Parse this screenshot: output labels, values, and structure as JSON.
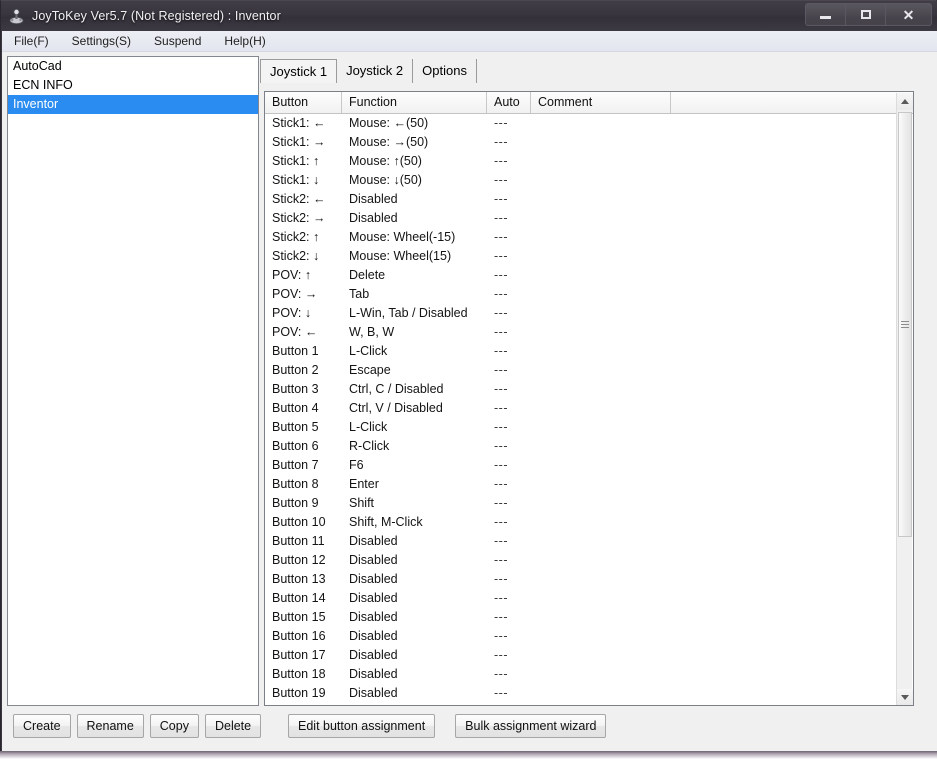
{
  "window": {
    "title": "JoyToKey Ver5.7 (Not Registered) : Inventor",
    "icon": "joystick-icon",
    "controls": {
      "minimize": "minimize-icon",
      "maximize": "maximize-icon",
      "close": "✕"
    }
  },
  "menubar": {
    "items": [
      {
        "label": "File(F)"
      },
      {
        "label": "Settings(S)"
      },
      {
        "label": "Suspend"
      },
      {
        "label": "Help(H)"
      }
    ]
  },
  "sidebar": {
    "profiles": [
      {
        "label": "AutoCad",
        "selected": false
      },
      {
        "label": "ECN INFO",
        "selected": false
      },
      {
        "label": "Inventor",
        "selected": true
      }
    ],
    "buttons": [
      {
        "label": "Create"
      },
      {
        "label": "Rename"
      },
      {
        "label": "Copy"
      },
      {
        "label": "Delete"
      }
    ],
    "selected_color": "#2a8cf0"
  },
  "main": {
    "tabs": [
      {
        "label": "Joystick 1",
        "active": true
      },
      {
        "label": "Joystick 2",
        "active": false
      },
      {
        "label": "Options",
        "active": false
      }
    ],
    "table": {
      "columns": [
        "Button",
        "Function",
        "Auto",
        "Comment",
        ""
      ],
      "rows": [
        {
          "button": "Stick1: ←",
          "function": "Mouse: ←(50)",
          "auto": "---",
          "comment": ""
        },
        {
          "button": "Stick1: →",
          "function": "Mouse: →(50)",
          "auto": "---",
          "comment": ""
        },
        {
          "button": "Stick1: ↑",
          "function": "Mouse: ↑(50)",
          "auto": "---",
          "comment": ""
        },
        {
          "button": "Stick1: ↓",
          "function": "Mouse: ↓(50)",
          "auto": "---",
          "comment": ""
        },
        {
          "button": "Stick2: ←",
          "function": "Disabled",
          "auto": "---",
          "comment": ""
        },
        {
          "button": "Stick2: →",
          "function": "Disabled",
          "auto": "---",
          "comment": ""
        },
        {
          "button": "Stick2: ↑",
          "function": "Mouse: Wheel(-15)",
          "auto": "---",
          "comment": ""
        },
        {
          "button": "Stick2: ↓",
          "function": "Mouse: Wheel(15)",
          "auto": "---",
          "comment": ""
        },
        {
          "button": "POV: ↑",
          "function": "Delete",
          "auto": "---",
          "comment": ""
        },
        {
          "button": "POV: →",
          "function": "Tab",
          "auto": "---",
          "comment": ""
        },
        {
          "button": "POV: ↓",
          "function": "L-Win, Tab / Disabled",
          "auto": "---",
          "comment": ""
        },
        {
          "button": "POV: ←",
          "function": "W, B, W",
          "auto": "---",
          "comment": ""
        },
        {
          "button": "Button 1",
          "function": "L-Click",
          "auto": "---",
          "comment": ""
        },
        {
          "button": "Button 2",
          "function": "Escape",
          "auto": "---",
          "comment": ""
        },
        {
          "button": "Button 3",
          "function": "Ctrl, C / Disabled",
          "auto": "---",
          "comment": ""
        },
        {
          "button": "Button 4",
          "function": "Ctrl, V / Disabled",
          "auto": "---",
          "comment": ""
        },
        {
          "button": "Button 5",
          "function": "L-Click",
          "auto": "---",
          "comment": ""
        },
        {
          "button": "Button 6",
          "function": "R-Click",
          "auto": "---",
          "comment": ""
        },
        {
          "button": "Button 7",
          "function": "F6",
          "auto": "---",
          "comment": ""
        },
        {
          "button": "Button 8",
          "function": "Enter",
          "auto": "---",
          "comment": ""
        },
        {
          "button": "Button 9",
          "function": "Shift",
          "auto": "---",
          "comment": ""
        },
        {
          "button": "Button 10",
          "function": "Shift, M-Click",
          "auto": "---",
          "comment": ""
        },
        {
          "button": "Button 11",
          "function": "Disabled",
          "auto": "---",
          "comment": ""
        },
        {
          "button": "Button 12",
          "function": "Disabled",
          "auto": "---",
          "comment": ""
        },
        {
          "button": "Button 13",
          "function": "Disabled",
          "auto": "---",
          "comment": ""
        },
        {
          "button": "Button 14",
          "function": "Disabled",
          "auto": "---",
          "comment": ""
        },
        {
          "button": "Button 15",
          "function": "Disabled",
          "auto": "---",
          "comment": ""
        },
        {
          "button": "Button 16",
          "function": "Disabled",
          "auto": "---",
          "comment": ""
        },
        {
          "button": "Button 17",
          "function": "Disabled",
          "auto": "---",
          "comment": ""
        },
        {
          "button": "Button 18",
          "function": "Disabled",
          "auto": "---",
          "comment": ""
        },
        {
          "button": "Button 19",
          "function": "Disabled",
          "auto": "---",
          "comment": ""
        }
      ]
    },
    "buttons": [
      {
        "label": "Edit button assignment"
      },
      {
        "label": "Bulk assignment wizard"
      }
    ]
  }
}
